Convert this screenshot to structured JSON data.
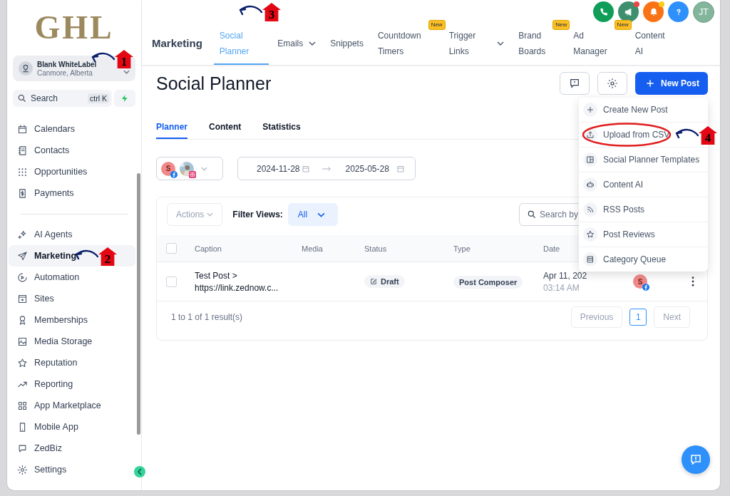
{
  "sidebar": {
    "logo": "GHL",
    "account": {
      "name": "Blank WhiteLabel",
      "location": "Canmore, Alberta"
    },
    "search": {
      "placeholder": "Search",
      "shortcut": "ctrl K"
    },
    "groups": [
      {
        "items": [
          {
            "label": "Calendars",
            "selected": false
          },
          {
            "label": "Contacts",
            "selected": false
          },
          {
            "label": "Opportunities",
            "selected": false
          },
          {
            "label": "Payments",
            "selected": false
          }
        ]
      },
      {
        "items": [
          {
            "label": "AI Agents",
            "selected": false
          },
          {
            "label": "Marketing",
            "selected": true
          },
          {
            "label": "Automation",
            "selected": false
          },
          {
            "label": "Sites",
            "selected": false
          },
          {
            "label": "Memberships",
            "selected": false
          },
          {
            "label": "Media Storage",
            "selected": false
          },
          {
            "label": "Reputation",
            "selected": false
          },
          {
            "label": "Reporting",
            "selected": false
          },
          {
            "label": "App Marketplace",
            "selected": false
          },
          {
            "label": "Mobile App",
            "selected": false
          },
          {
            "label": "ZedBiz",
            "selected": false
          },
          {
            "label": "Settings",
            "selected": false
          }
        ]
      }
    ]
  },
  "topbar": {
    "header_buttons": [
      {
        "kind": "phone",
        "unread": false
      },
      {
        "kind": "megaphone",
        "unread": true
      },
      {
        "kind": "bell",
        "unread": true
      },
      {
        "kind": "help",
        "unread": false
      }
    ],
    "avatar": "JT",
    "section": "Marketing",
    "tabs": [
      {
        "label": "Social Planner",
        "selected": true,
        "menu": false
      },
      {
        "label": "Emails",
        "selected": false,
        "menu": true
      },
      {
        "label": "Snippets",
        "selected": false,
        "menu": false
      },
      {
        "label": "Countdown Timers",
        "selected": false,
        "menu": false,
        "badge": "New"
      },
      {
        "label": "Trigger Links",
        "selected": false,
        "menu": true
      },
      {
        "label": "Brand Boards",
        "selected": false,
        "menu": false,
        "badge": "New"
      },
      {
        "label": "Ad Manager",
        "selected": false,
        "menu": false,
        "badge": "New"
      },
      {
        "label": "Content AI",
        "selected": false,
        "menu": false
      }
    ]
  },
  "page": {
    "title": "Social Planner",
    "new_post": "New Post",
    "tabs": [
      {
        "label": "Planner",
        "selected": true
      },
      {
        "label": "Content",
        "selected": false
      },
      {
        "label": "Statistics",
        "selected": false
      }
    ],
    "accounts": [
      {
        "kind": "initial",
        "initial": "S",
        "network": {
          "kind": "facebook"
        }
      },
      {
        "kind": "picture",
        "network": {
          "kind": "instagram"
        }
      }
    ],
    "date_range": {
      "start": "2024-11-28",
      "end": "2025-05-28"
    },
    "table": {
      "actions": "Actions",
      "filter_label": "Filter Views:",
      "filter_value": "All",
      "search_placeholder": "Search by",
      "header_checked": false,
      "columns": [
        "Caption",
        "Media",
        "Status",
        "Type",
        "Date"
      ],
      "rows": [
        {
          "checked": false,
          "caption": "Test Post >",
          "link": "https://link.zednow.c...",
          "status": "Draft",
          "type": "Post Composer",
          "date": "Apr 11, 202",
          "time": "03:14 AM",
          "account_initial": "S",
          "network": {
            "kind": "facebook"
          }
        }
      ],
      "footer": {
        "summary": "1 to 1 of 1 result(s)",
        "previous": "Previous",
        "page": "1",
        "next": "Next"
      }
    }
  },
  "menu": {
    "items": [
      "Create New Post",
      "Upload from CSV",
      "Social Planner Templates",
      "Content AI",
      "RSS Posts",
      "Post Reviews",
      "Category Queue"
    ]
  },
  "annotations": [
    {
      "number": "1"
    },
    {
      "number": "2"
    },
    {
      "number": "3"
    },
    {
      "number": "4"
    }
  ]
}
